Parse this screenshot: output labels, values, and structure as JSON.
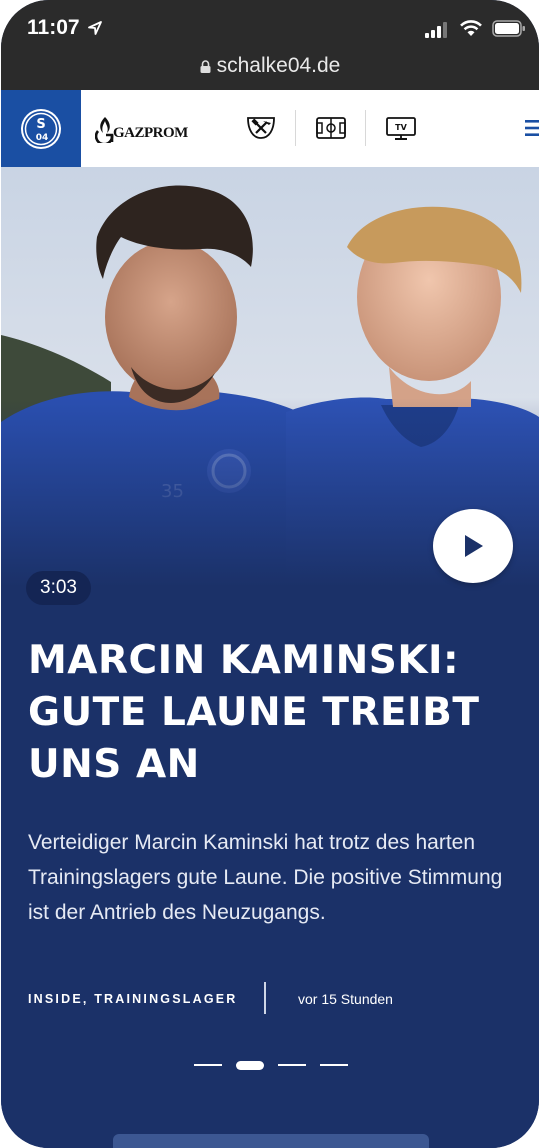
{
  "status_bar": {
    "time": "11:07",
    "icons": [
      "location-arrow-icon",
      "cellular-signal-icon",
      "wifi-icon",
      "battery-icon"
    ]
  },
  "browser": {
    "url": "schalke04.de",
    "icons": [
      "lock-icon"
    ]
  },
  "header": {
    "club_logo": "schalke-04-crest-icon",
    "sponsor": "GAZPROM",
    "nav_icons": [
      "hammer-and-pick-icon",
      "pitch-icon",
      "tv-icon",
      "menu-icon"
    ],
    "tv_icon_label": "TV"
  },
  "hero": {
    "duration": "3:03",
    "headline": "MARCIN KAMINSKI: GUTE LAUNE TREIBT UNS AN",
    "teaser": "Verteidiger Marcin Kaminski hat trotz des harten Trainingslagers gute Laune. Die positive Stimmung ist der Antrieb des Neuzugangs.",
    "category": "INSIDE, TRAININGSLAGER",
    "time_ago": "vor 15 Stunden",
    "pager": {
      "count": 4,
      "active_index": 1
    }
  },
  "colors": {
    "brand_blue": "#1a4fa3",
    "hero_navy": "#1b3168",
    "chrome_dark": "#2b2b2b"
  }
}
